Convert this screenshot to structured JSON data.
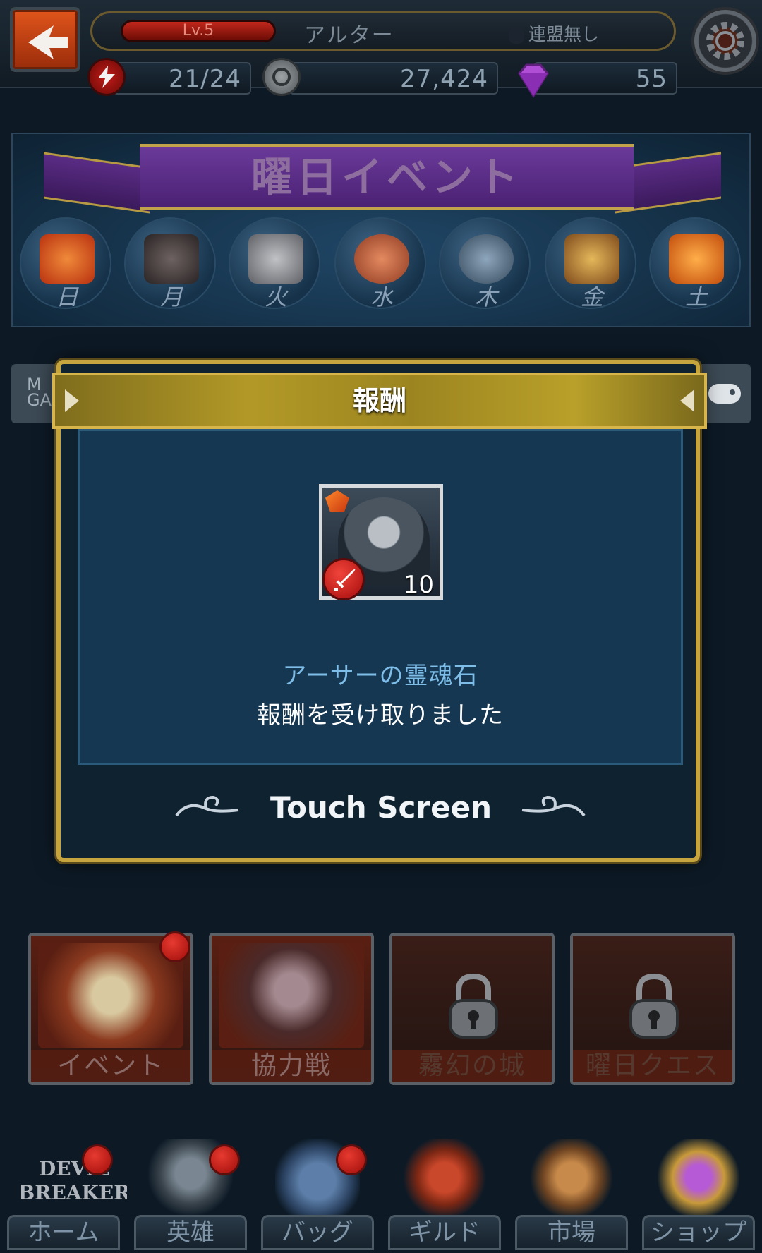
{
  "header": {
    "level": "Lv.5",
    "player_name": "アルター",
    "alliance": "連盟無し",
    "energy": "21/24",
    "gold": "27,424",
    "gems": "55"
  },
  "event_banner": {
    "title": "曜日イベント",
    "days": [
      {
        "label": "日",
        "icon": "fire-gem-icon",
        "color": "#d7461f"
      },
      {
        "label": "月",
        "icon": "skull-icon",
        "color": "#4b4040"
      },
      {
        "label": "火",
        "icon": "silver-chest-icon",
        "color": "#8d8f93"
      },
      {
        "label": "水",
        "icon": "handshake-icon",
        "color": "#b85a3a"
      },
      {
        "label": "木",
        "icon": "crossed-swords-icon",
        "color": "#5a6e80"
      },
      {
        "label": "金",
        "icon": "treasure-chest-icon",
        "color": "#b88a3a"
      },
      {
        "label": "土",
        "icon": "orange-crystals-icon",
        "color": "#e0761e"
      }
    ]
  },
  "side_tab_left": "M\nGA",
  "popup": {
    "title": "報酬",
    "reward_count": "10",
    "reward_name": "アーサーの霊魂石",
    "reward_message": "報酬を受け取りました",
    "touch_prompt": "Touch Screen"
  },
  "modes": [
    {
      "label": "イベント",
      "locked": false,
      "badge": true
    },
    {
      "label": "協力戦",
      "locked": false,
      "badge": false
    },
    {
      "label": "霧幻の城",
      "locked": true,
      "badge": false
    },
    {
      "label": "曜日クエスト",
      "locked": true,
      "badge": false
    }
  ],
  "nav": [
    {
      "label": "ホーム",
      "badge": true
    },
    {
      "label": "英雄",
      "badge": true
    },
    {
      "label": "バッグ",
      "badge": true
    },
    {
      "label": "ギルド",
      "badge": false
    },
    {
      "label": "市場",
      "badge": false
    },
    {
      "label": "ショップ",
      "badge": false
    }
  ],
  "logo_text": "DEVIL BREAKER"
}
